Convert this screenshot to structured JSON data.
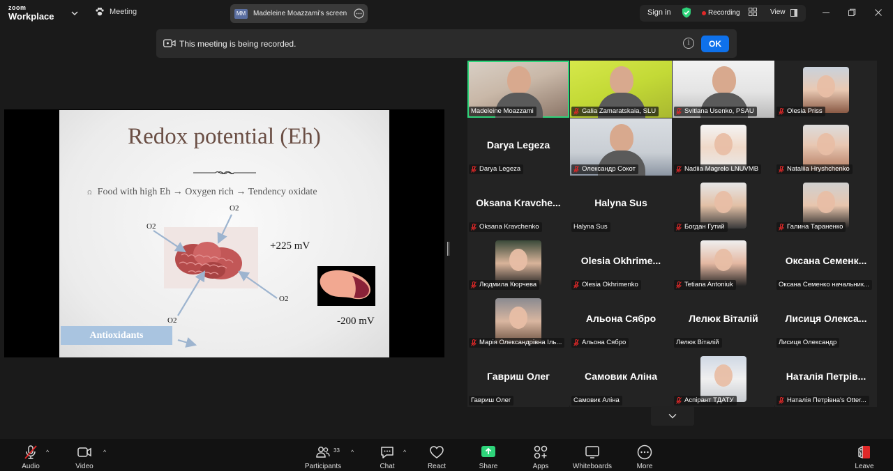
{
  "titlebar": {
    "logo_top": "zoom",
    "logo_bottom": "Workplace",
    "meeting_label": "Meeting",
    "screen_badge": "MM",
    "screen_label": "Madeleine Moazzami's screen",
    "signin_label": "Sign in",
    "recording_label": "Recording",
    "view_label": "View",
    "icons": [
      "chevron-down-icon",
      "paw-icon",
      "more-icon",
      "shield-check-icon",
      "grid-icon",
      "view-icon",
      "minimize-icon",
      "maximize-icon",
      "close-icon"
    ],
    "recording_color": "#e02828",
    "shield_color": "#2ed47a"
  },
  "banner": {
    "message": "This meeting is being recorded.",
    "info_glyph": "i",
    "ok_label": "OK",
    "accent": "#0e71eb"
  },
  "slide": {
    "title": "Redox potential (Eh)",
    "bullet_glyph": "ꭥ",
    "bullet": "Food with high Eh → Oxygen rich → Tendency oxidate",
    "o2_label": "O2",
    "pos_mv": "+225 mV",
    "neg_mv": "-200 mV",
    "antioxidants": "Antioxidants"
  },
  "gallery": {
    "active_color": "#2ed47a",
    "tiles": [
      {
        "name": "Madeleine Moazzami",
        "kind": "video",
        "muted": false
      },
      {
        "name": "Galia Zamaratskaia, SLU",
        "kind": "video",
        "muted": true
      },
      {
        "name": "Svitlana Usenko, PSAU",
        "kind": "video",
        "muted": true
      },
      {
        "name": "Olesia Priss",
        "kind": "avatar",
        "muted": true
      },
      {
        "name": "Darya Legeza",
        "big": "Darya Legeza",
        "kind": "text",
        "muted": true
      },
      {
        "name": "Олександр Сокот",
        "kind": "video",
        "muted": true
      },
      {
        "name": "Nadiia Magrelo LNUVMB",
        "kind": "avatar",
        "muted": true
      },
      {
        "name": "Nataliia Hryshchenko",
        "kind": "avatar",
        "muted": true
      },
      {
        "name": "Oksana Kravchenko",
        "big": "Oksana  Kravche...",
        "kind": "text",
        "muted": true
      },
      {
        "name": "Halyna Sus",
        "big": "Halyna Sus",
        "kind": "text",
        "muted": false
      },
      {
        "name": "Богдан Гутий",
        "kind": "avatar",
        "muted": true
      },
      {
        "name": "Галина Тараненко",
        "kind": "avatar",
        "muted": true
      },
      {
        "name": "Людмила Кюрчева",
        "kind": "avatar",
        "muted": true
      },
      {
        "name": "Olesia Okhrimenko",
        "big": "Olesia  Okhrime...",
        "kind": "text",
        "muted": true
      },
      {
        "name": "Tetiana Antoniuk",
        "kind": "avatar",
        "muted": true
      },
      {
        "name": "Оксана Семенко начальник...",
        "big": "Оксана  Семенк...",
        "kind": "text",
        "muted": false
      },
      {
        "name": "Марія Олександрівна Іль...",
        "kind": "avatar",
        "muted": true
      },
      {
        "name": "Альона Сябро",
        "big": "Альона Сябро",
        "kind": "text",
        "muted": true
      },
      {
        "name": "Лелюк Віталій",
        "big": "Лелюк Віталій",
        "kind": "text",
        "muted": false
      },
      {
        "name": "Лисиця Олександр",
        "big": "Лисиця  Олекса...",
        "kind": "text",
        "muted": false
      },
      {
        "name": "Гавриш Олег",
        "big": "Гавриш Олег",
        "kind": "text",
        "muted": false
      },
      {
        "name": "Самовик Аліна",
        "big": "Самовик Аліна",
        "kind": "text",
        "muted": false
      },
      {
        "name": "Аспірант ТДАТУ",
        "kind": "avatar",
        "muted": true
      },
      {
        "name": "Наталія Петрівна's Otter...",
        "big": "Наталія  Петрів...",
        "kind": "text",
        "muted": true
      }
    ],
    "scroll_glyph": "⌄"
  },
  "toolbar": {
    "audio": "Audio",
    "video": "Video",
    "participants": "Participants",
    "participants_count": "33",
    "chat": "Chat",
    "react": "React",
    "share": "Share",
    "apps": "Apps",
    "whiteboards": "Whiteboards",
    "more": "More",
    "leave": "Leave",
    "caret": "^",
    "share_color": "#2ed47a",
    "leave_color": "#e02828"
  }
}
